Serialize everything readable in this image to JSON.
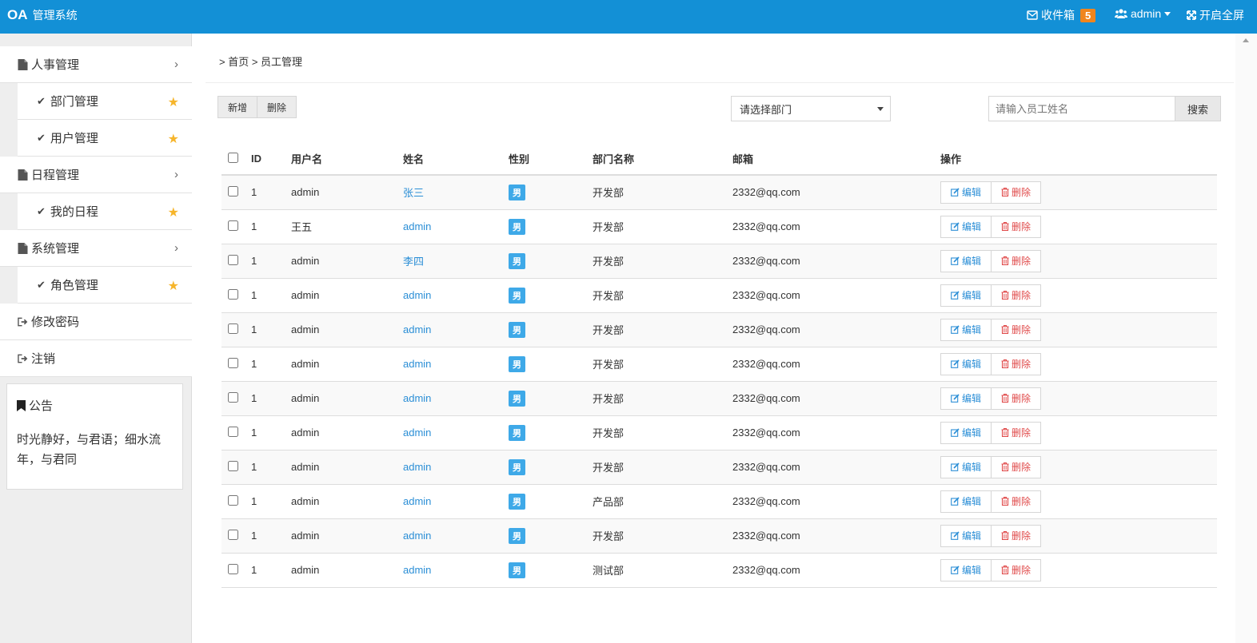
{
  "header": {
    "brand": "OA",
    "brand_sub": "管理系统",
    "inbox_label": "收件箱",
    "inbox_count": "5",
    "user_label": "admin",
    "fullscreen_label": "开启全屏"
  },
  "sidebar": {
    "groups": [
      {
        "label": "人事管理",
        "children": [
          "部门管理",
          "用户管理"
        ]
      },
      {
        "label": "日程管理",
        "children": [
          "我的日程"
        ]
      },
      {
        "label": "系统管理",
        "children": [
          "角色管理"
        ]
      }
    ],
    "extra": [
      "修改密码",
      "注销"
    ],
    "notice_title": "公告",
    "notice_text": "时光静好，与君语；细水流年，与君同"
  },
  "main": {
    "breadcrumb": "> 首页 > 员工管理",
    "add_label": "新增",
    "delete_label": "删除",
    "dept_select": "请选择部门",
    "search_placeholder": "请输入员工姓名",
    "search_label": "搜索",
    "columns": [
      "ID",
      "用户名",
      "姓名",
      "性别",
      "部门名称",
      "邮箱",
      "操作"
    ],
    "edit_label": "编辑",
    "row_delete_label": "删除",
    "rows": [
      {
        "id": "1",
        "username": "admin",
        "name": "张三",
        "gender": "男",
        "dept": "开发部",
        "email": "2332@qq.com"
      },
      {
        "id": "1",
        "username": "王五",
        "name": "admin",
        "gender": "男",
        "dept": "开发部",
        "email": "2332@qq.com"
      },
      {
        "id": "1",
        "username": "admin",
        "name": "李四",
        "gender": "男",
        "dept": "开发部",
        "email": "2332@qq.com"
      },
      {
        "id": "1",
        "username": "admin",
        "name": "admin",
        "gender": "男",
        "dept": "开发部",
        "email": "2332@qq.com"
      },
      {
        "id": "1",
        "username": "admin",
        "name": "admin",
        "gender": "男",
        "dept": "开发部",
        "email": "2332@qq.com"
      },
      {
        "id": "1",
        "username": "admin",
        "name": "admin",
        "gender": "男",
        "dept": "开发部",
        "email": "2332@qq.com"
      },
      {
        "id": "1",
        "username": "admin",
        "name": "admin",
        "gender": "男",
        "dept": "开发部",
        "email": "2332@qq.com"
      },
      {
        "id": "1",
        "username": "admin",
        "name": "admin",
        "gender": "男",
        "dept": "开发部",
        "email": "2332@qq.com"
      },
      {
        "id": "1",
        "username": "admin",
        "name": "admin",
        "gender": "男",
        "dept": "开发部",
        "email": "2332@qq.com"
      },
      {
        "id": "1",
        "username": "admin",
        "name": "admin",
        "gender": "男",
        "dept": "产品部",
        "email": "2332@qq.com"
      },
      {
        "id": "1",
        "username": "admin",
        "name": "admin",
        "gender": "男",
        "dept": "开发部",
        "email": "2332@qq.com"
      },
      {
        "id": "1",
        "username": "admin",
        "name": "admin",
        "gender": "男",
        "dept": "测试部",
        "email": "2332@qq.com"
      }
    ]
  },
  "colors": {
    "header_bg": "#1390d6",
    "badge": "#f0851d",
    "link": "#2a8ed6",
    "gender_badge": "#3ea9e8",
    "delete": "#e04a4a",
    "star": "#f6b52b"
  },
  "icons": {
    "inbox": "envelope-icon",
    "user": "users-icon",
    "fullscreen": "expand-icon",
    "menu_group": "file-icon",
    "menu_child": "check-icon",
    "favorite": "star-icon",
    "extra": "sign-out-icon",
    "notice": "bookmark-icon",
    "edit": "edit-icon",
    "delete": "trash-icon"
  }
}
